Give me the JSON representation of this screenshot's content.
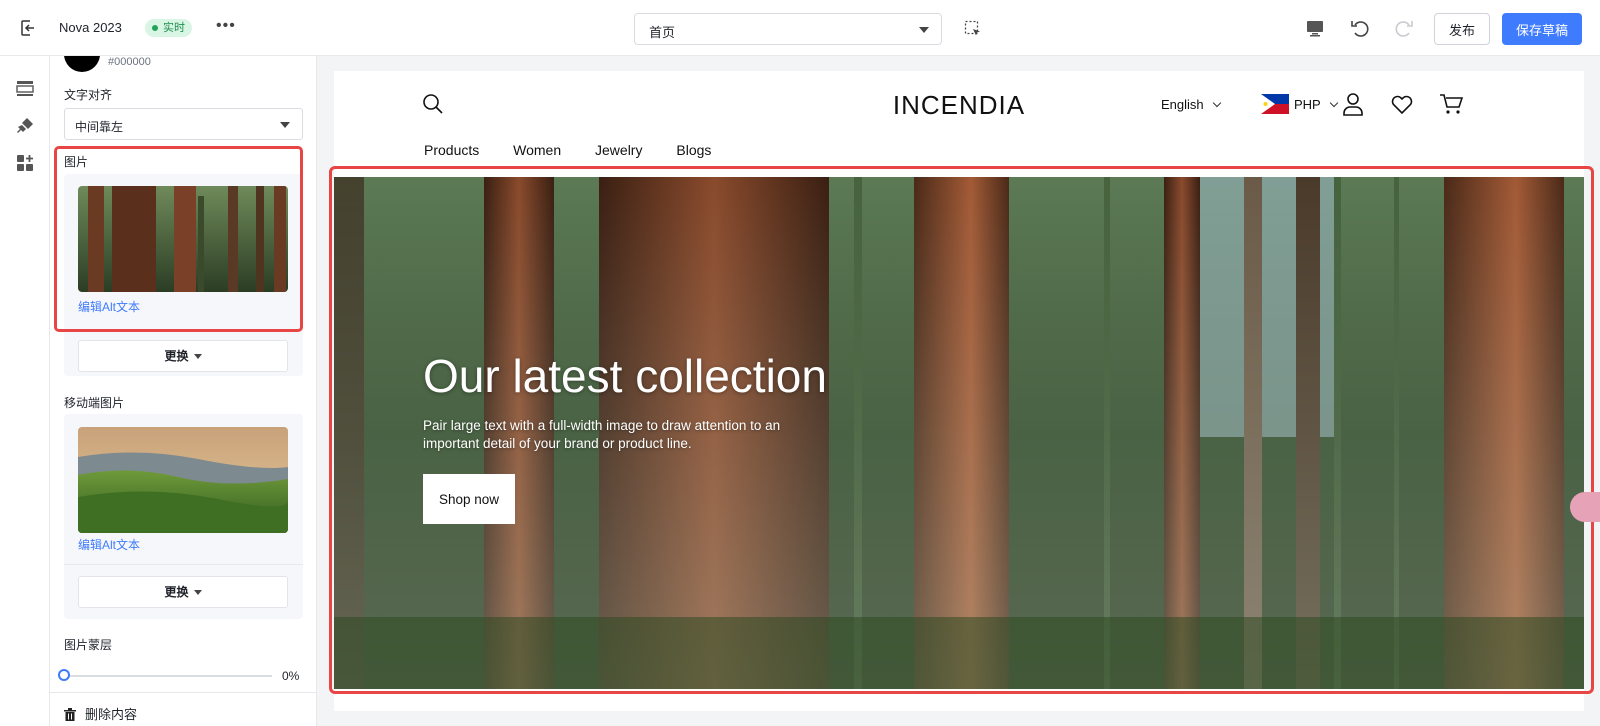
{
  "topbar": {
    "theme_name": "Nova 2023",
    "live_badge": "实时",
    "more_label": "•••",
    "page_select": "首页",
    "publish_label": "发布",
    "save_draft_label": "保存草稿"
  },
  "panel": {
    "color_hex": "#000000",
    "text_align_label": "文字对齐",
    "text_align_value": "中间靠左",
    "image_label": "图片",
    "edit_alt_text": "编辑Alt文本",
    "replace_label": "更换",
    "mobile_image_label": "移动端图片",
    "mobile_edit_alt_text": "编辑Alt文本",
    "mobile_replace_label": "更换",
    "overlay_label": "图片蒙层",
    "overlay_value": "0%",
    "overlay_fraction": 0,
    "delete_label": "删除内容"
  },
  "store": {
    "logo": "INCENDIA",
    "language": "English",
    "currency": "PHP",
    "nav": [
      "Products",
      "Women",
      "Jewelry",
      "Blogs"
    ],
    "hero_title": "Our latest collection",
    "hero_text": "Pair large text with a full-width image to draw attention to an important detail of your brand or product line.",
    "shop_button": "Shop now"
  },
  "colors": {
    "accent": "#3f7bfd",
    "highlight": "#e84545",
    "live_badge_bg": "#d9f5e4"
  }
}
